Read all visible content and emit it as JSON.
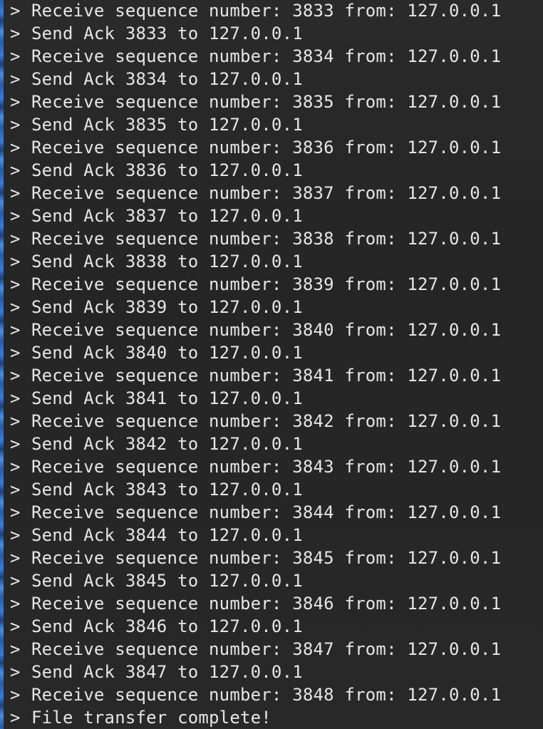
{
  "console": {
    "prompt": ">",
    "lines": [
      "Receive sequence number: 3833 from: 127.0.0.1",
      "Send Ack 3833 to 127.0.0.1",
      "Receive sequence number: 3834 from: 127.0.0.1",
      "Send Ack 3834 to 127.0.0.1",
      "Receive sequence number: 3835 from: 127.0.0.1",
      "Send Ack 3835 to 127.0.0.1",
      "Receive sequence number: 3836 from: 127.0.0.1",
      "Send Ack 3836 to 127.0.0.1",
      "Receive sequence number: 3837 from: 127.0.0.1",
      "Send Ack 3837 to 127.0.0.1",
      "Receive sequence number: 3838 from: 127.0.0.1",
      "Send Ack 3838 to 127.0.0.1",
      "Receive sequence number: 3839 from: 127.0.0.1",
      "Send Ack 3839 to 127.0.0.1",
      "Receive sequence number: 3840 from: 127.0.0.1",
      "Send Ack 3840 to 127.0.0.1",
      "Receive sequence number: 3841 from: 127.0.0.1",
      "Send Ack 3841 to 127.0.0.1",
      "Receive sequence number: 3842 from: 127.0.0.1",
      "Send Ack 3842 to 127.0.0.1",
      "Receive sequence number: 3843 from: 127.0.0.1",
      "Send Ack 3843 to 127.0.0.1",
      "Receive sequence number: 3844 from: 127.0.0.1",
      "Send Ack 3844 to 127.0.0.1",
      "Receive sequence number: 3845 from: 127.0.0.1",
      "Send Ack 3845 to 127.0.0.1",
      "Receive sequence number: 3846 from: 127.0.0.1",
      "Send Ack 3846 to 127.0.0.1",
      "Receive sequence number: 3847 from: 127.0.0.1",
      "Send Ack 3847 to 127.0.0.1",
      "Receive sequence number: 3848 from: 127.0.0.1",
      "File transfer complete!"
    ]
  },
  "colors": {
    "background": "#262626",
    "text": "#e6e6e6"
  }
}
